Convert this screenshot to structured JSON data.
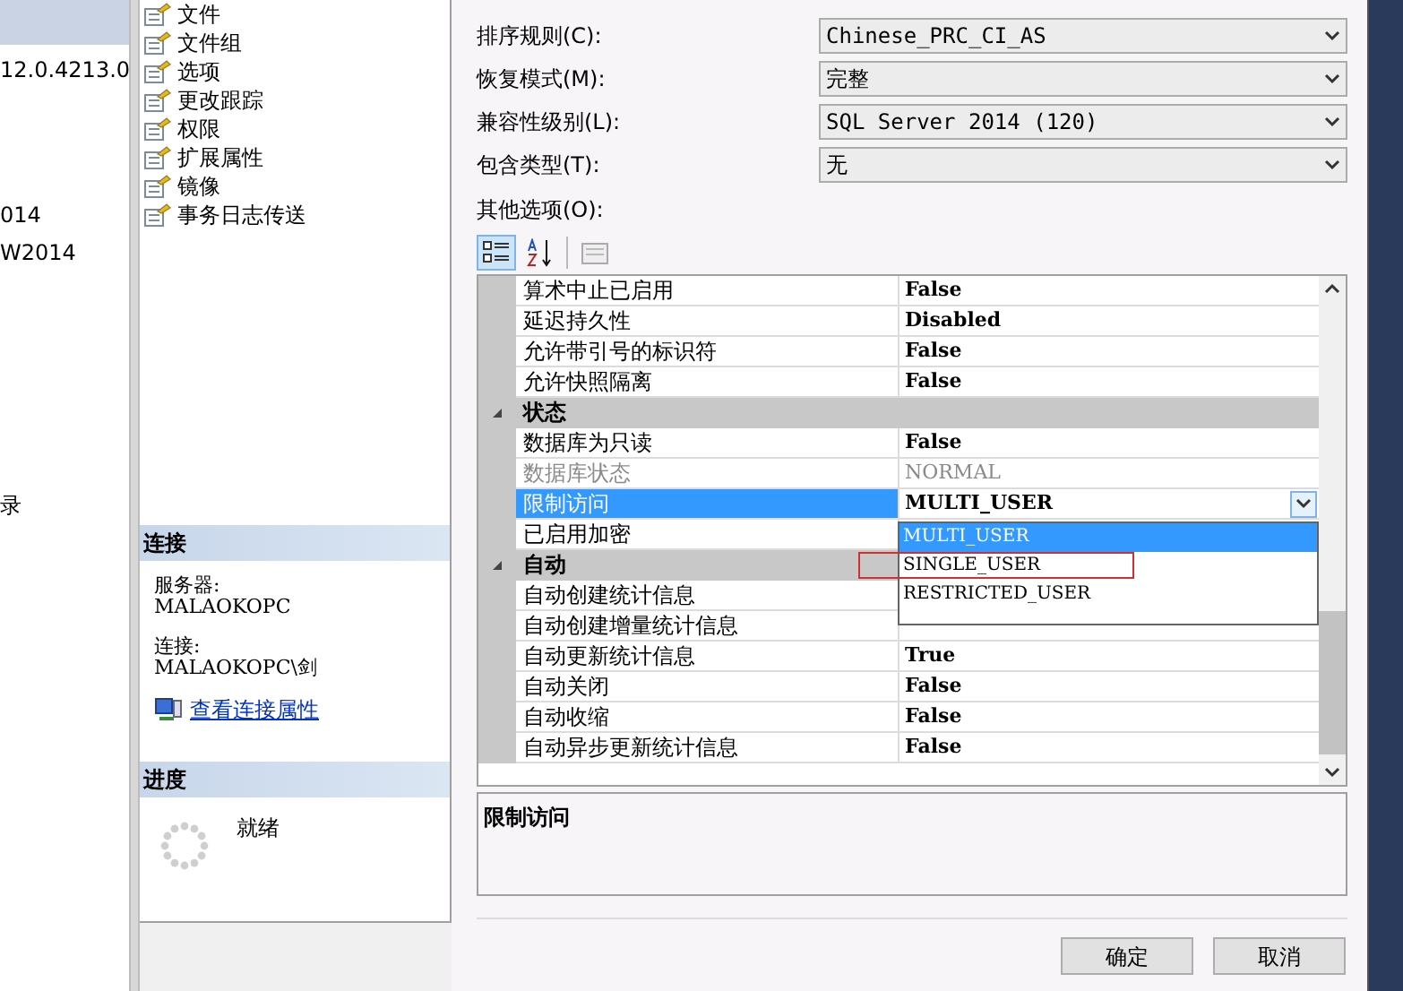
{
  "background_window": {
    "texts": [
      "12.0.4213.0",
      "014",
      "W2014",
      "录"
    ]
  },
  "pages": [
    "文件",
    "文件组",
    "选项",
    "更改跟踪",
    "权限",
    "扩展属性",
    "镜像",
    "事务日志传送"
  ],
  "connection": {
    "title": "连接",
    "server_label": "服务器:",
    "server": "MALAOKOPC",
    "connection_label": "连接:",
    "connection": "MALAOKOPC\\剑",
    "link": "查看连接属性"
  },
  "progress": {
    "title": "进度",
    "status": "就绪"
  },
  "fields": [
    {
      "label": "排序规则(C):",
      "value": "Chinese_PRC_CI_AS"
    },
    {
      "label": "恢复模式(M):",
      "value": "完整"
    },
    {
      "label": "兼容性级别(L):",
      "value": "SQL Server 2014 (120)"
    },
    {
      "label": "包含类型(T):",
      "value": "无"
    }
  ],
  "other_options_label": "其他选项(O):",
  "toolbar": [
    {
      "kind": "categorized",
      "selected": true
    },
    {
      "kind": "alphabetical",
      "selected": false
    },
    {
      "kind": "pages",
      "selected": false
    }
  ],
  "grid": {
    "rows": [
      {
        "kind": "property",
        "name": "算术中止已启用",
        "value": "False",
        "selected": false,
        "disabled": false
      },
      {
        "kind": "property",
        "name": "延迟持久性",
        "value": "Disabled",
        "selected": false,
        "disabled": false
      },
      {
        "kind": "property",
        "name": "允许带引号的标识符",
        "value": "False",
        "selected": false,
        "disabled": false
      },
      {
        "kind": "property",
        "name": "允许快照隔离",
        "value": "False",
        "selected": false,
        "disabled": false
      },
      {
        "kind": "category",
        "name": "状态",
        "expanded": true
      },
      {
        "kind": "property",
        "name": "数据库为只读",
        "value": "False",
        "selected": false,
        "disabled": false
      },
      {
        "kind": "property",
        "name": "数据库状态",
        "value": "NORMAL",
        "selected": false,
        "disabled": true
      },
      {
        "kind": "property",
        "name": "限制访问",
        "value": "MULTI_USER",
        "selected": true,
        "disabled": false
      },
      {
        "kind": "property",
        "name": "已启用加密",
        "selected": false,
        "disabled": false
      },
      {
        "kind": "category",
        "name": "自动",
        "expanded": true
      },
      {
        "kind": "property",
        "name": "自动创建统计信息",
        "selected": false,
        "disabled": false
      },
      {
        "kind": "property",
        "name": "自动创建增量统计信息",
        "selected": false,
        "disabled": false
      },
      {
        "kind": "property",
        "name": "自动更新统计信息",
        "value": "True",
        "selected": false,
        "disabled": false
      },
      {
        "kind": "property",
        "name": "自动关闭",
        "value": "False",
        "selected": false,
        "disabled": false
      },
      {
        "kind": "property",
        "name": "自动收缩",
        "value": "False",
        "selected": false,
        "disabled": false
      },
      {
        "kind": "property",
        "name": "自动异步更新统计信息",
        "value": "False",
        "selected": false,
        "disabled": false
      }
    ]
  },
  "dropdown": {
    "options": [
      {
        "label": "MULTI_USER",
        "selected": true
      },
      {
        "label": "SINGLE_USER",
        "selected": false
      },
      {
        "label": "RESTRICTED_USER",
        "selected": false
      }
    ]
  },
  "description": {
    "title": "限制访问"
  },
  "buttons": [
    "确定",
    "取消"
  ]
}
